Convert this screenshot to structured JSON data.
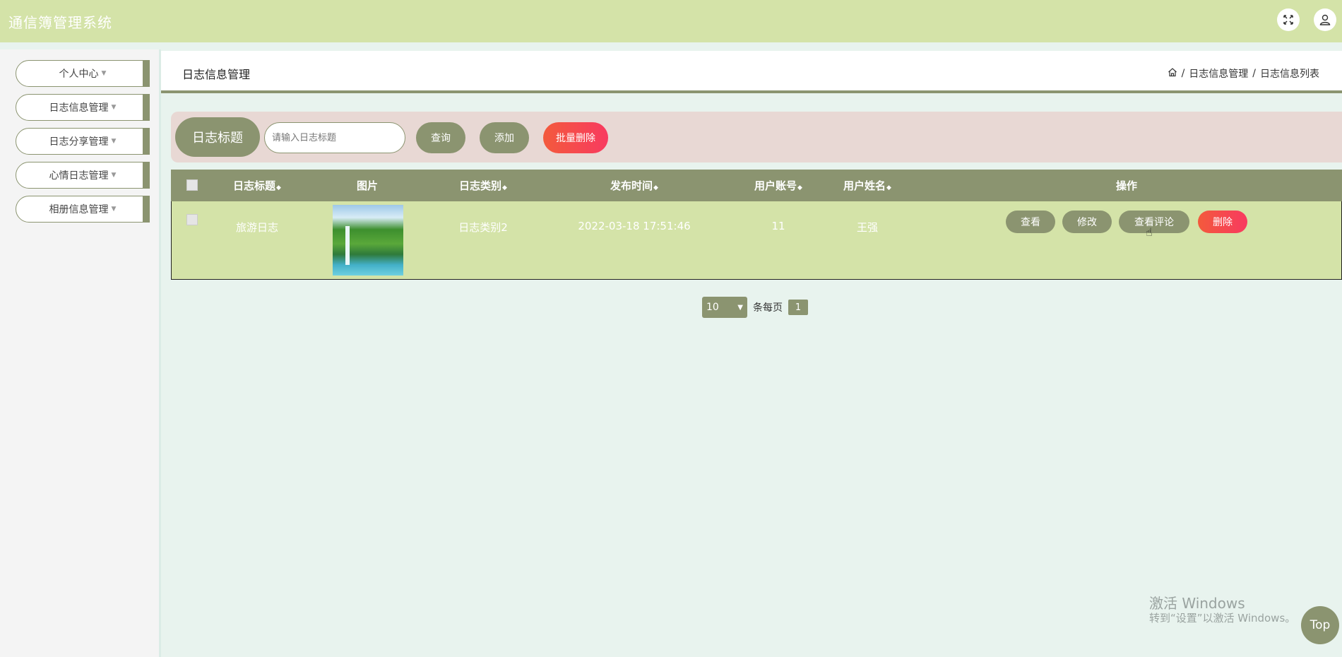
{
  "app": {
    "title": "通信簿管理系统"
  },
  "topbar": {
    "expand_icon": "expand-icon",
    "user_icon": "user-icon"
  },
  "sidebar": {
    "items": [
      {
        "label": "个人中心"
      },
      {
        "label": "日志信息管理"
      },
      {
        "label": "日志分享管理"
      },
      {
        "label": "心情日志管理"
      },
      {
        "label": "相册信息管理"
      }
    ]
  },
  "header": {
    "title": "日志信息管理",
    "breadcrumb": {
      "home_icon": "home-icon",
      "sep": "/",
      "level1": "日志信息管理",
      "level2": "日志信息列表"
    }
  },
  "search": {
    "label": "日志标题",
    "placeholder": "请输入日志标题",
    "query_label": "查询",
    "add_label": "添加",
    "batch_delete_label": "批量删除"
  },
  "table": {
    "headers": [
      "日志标题",
      "图片",
      "日志类别",
      "发布时间",
      "用户账号",
      "用户姓名",
      "操作"
    ],
    "rows": [
      {
        "title": "旅游日志",
        "category": "日志类别2",
        "time": "2022-03-18 17:51:46",
        "account": "11",
        "name": "王强",
        "actions": {
          "view": "查看",
          "edit": "修改",
          "comments": "查看评论",
          "delete": "删除"
        }
      }
    ]
  },
  "pagination": {
    "page_size": "10",
    "per_page_label": "条每页",
    "current_page": "1"
  },
  "watermark": {
    "line1": "激活 Windows",
    "line2": "转到“设置”以激活 Windows。"
  },
  "top_button": {
    "label": "Top"
  },
  "colors": {
    "topbar": "#d4e3a8",
    "accent": "#8b9470",
    "danger": "#f83a60",
    "row": "#d4e3a8"
  }
}
